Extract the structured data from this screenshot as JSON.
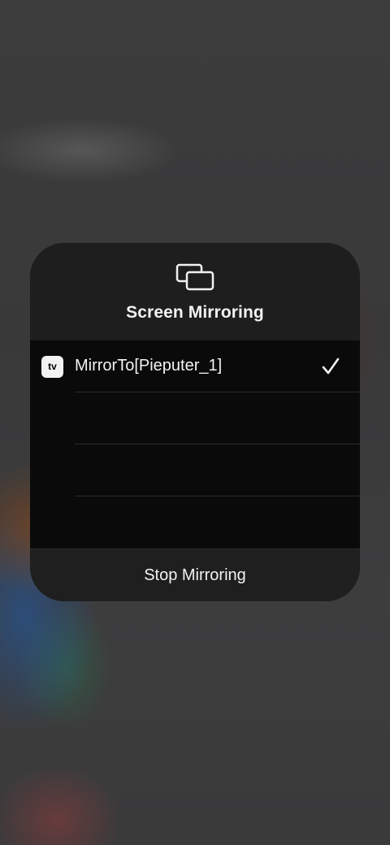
{
  "mirroring_panel": {
    "title": "Screen Mirroring",
    "header_icon": "screen-mirroring-icon",
    "devices": [
      {
        "name": "MirrorTo[Pieputer_1]",
        "type_badge": "tv",
        "badge_icon": "apple-tv-icon",
        "selected": true
      }
    ],
    "stop_label": "Stop Mirroring"
  }
}
